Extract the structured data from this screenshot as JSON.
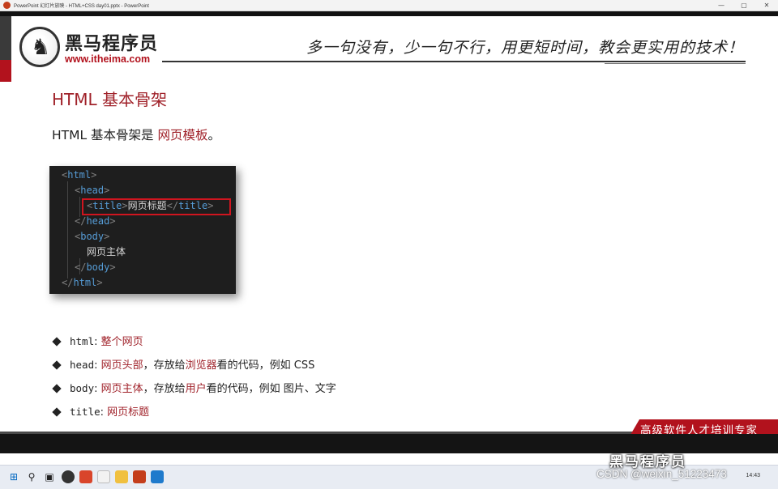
{
  "window": {
    "title": "PowerPoint 幻灯片放映  -  HTML+CSS day01.pptx  -  PowerPoint",
    "controls": [
      "—",
      "▢",
      "✕"
    ]
  },
  "brand": {
    "logo_name": "黑马程序员",
    "logo_url": "www.itheima.com",
    "slogan": "多一句没有，少一句不行，用更短时间，教会更实用的技术！",
    "footer_slogan": "高级软件人才培训专家"
  },
  "slide": {
    "heading": "HTML 基本骨架",
    "intro_prefix": "HTML 基本骨架是 ",
    "intro_highlight": "网页模板",
    "intro_suffix": "。",
    "code": {
      "lines": [
        {
          "open": "<",
          "tag": "html",
          "close": ">"
        },
        {
          "open": "<",
          "tag": "head",
          "close": ">"
        },
        {
          "open": "<",
          "tag": "title",
          "close": ">",
          "text": "网页标题",
          "end_open": "</",
          "end_tag": "title",
          "end_close": ">"
        },
        {
          "open": "</",
          "tag": "head",
          "close": ">"
        },
        {
          "open": "<",
          "tag": "body",
          "close": ">"
        },
        {
          "text": "网页主体"
        },
        {
          "open": "</",
          "tag": "body",
          "close": ">"
        },
        {
          "open": "</",
          "tag": "html",
          "close": ">"
        }
      ]
    },
    "bullets": [
      {
        "term": "html",
        "sep": ": ",
        "parts": [
          {
            "text": "整个网页",
            "hl": true
          }
        ]
      },
      {
        "term": "head",
        "sep": ": ",
        "parts": [
          {
            "text": "网页头部",
            "hl": true
          },
          {
            "text": "，存放给",
            "hl": false
          },
          {
            "text": "浏览器",
            "hl": true
          },
          {
            "text": "看的代码，例如 CSS",
            "hl": false
          }
        ]
      },
      {
        "term": "body",
        "sep": ": ",
        "parts": [
          {
            "text": "网页主体",
            "hl": true
          },
          {
            "text": "，存放给",
            "hl": false
          },
          {
            "text": "用户",
            "hl": true
          },
          {
            "text": "看的代码，例如 图片、文字",
            "hl": false
          }
        ]
      },
      {
        "term": "title",
        "sep": ": ",
        "parts": [
          {
            "text": "网页标题",
            "hl": true
          }
        ]
      }
    ]
  },
  "overlay": {
    "watermark_logo": "黑马程序员",
    "csdn": "CSDN @weixin_51223473"
  },
  "taskbar": {
    "time": "14:43"
  },
  "colors": {
    "accent_red": "#a0222a",
    "brand_red": "#b2121d",
    "code_bg": "#1e1e1e",
    "code_tag": "#569cd6",
    "highlight_box": "#d0151f"
  }
}
